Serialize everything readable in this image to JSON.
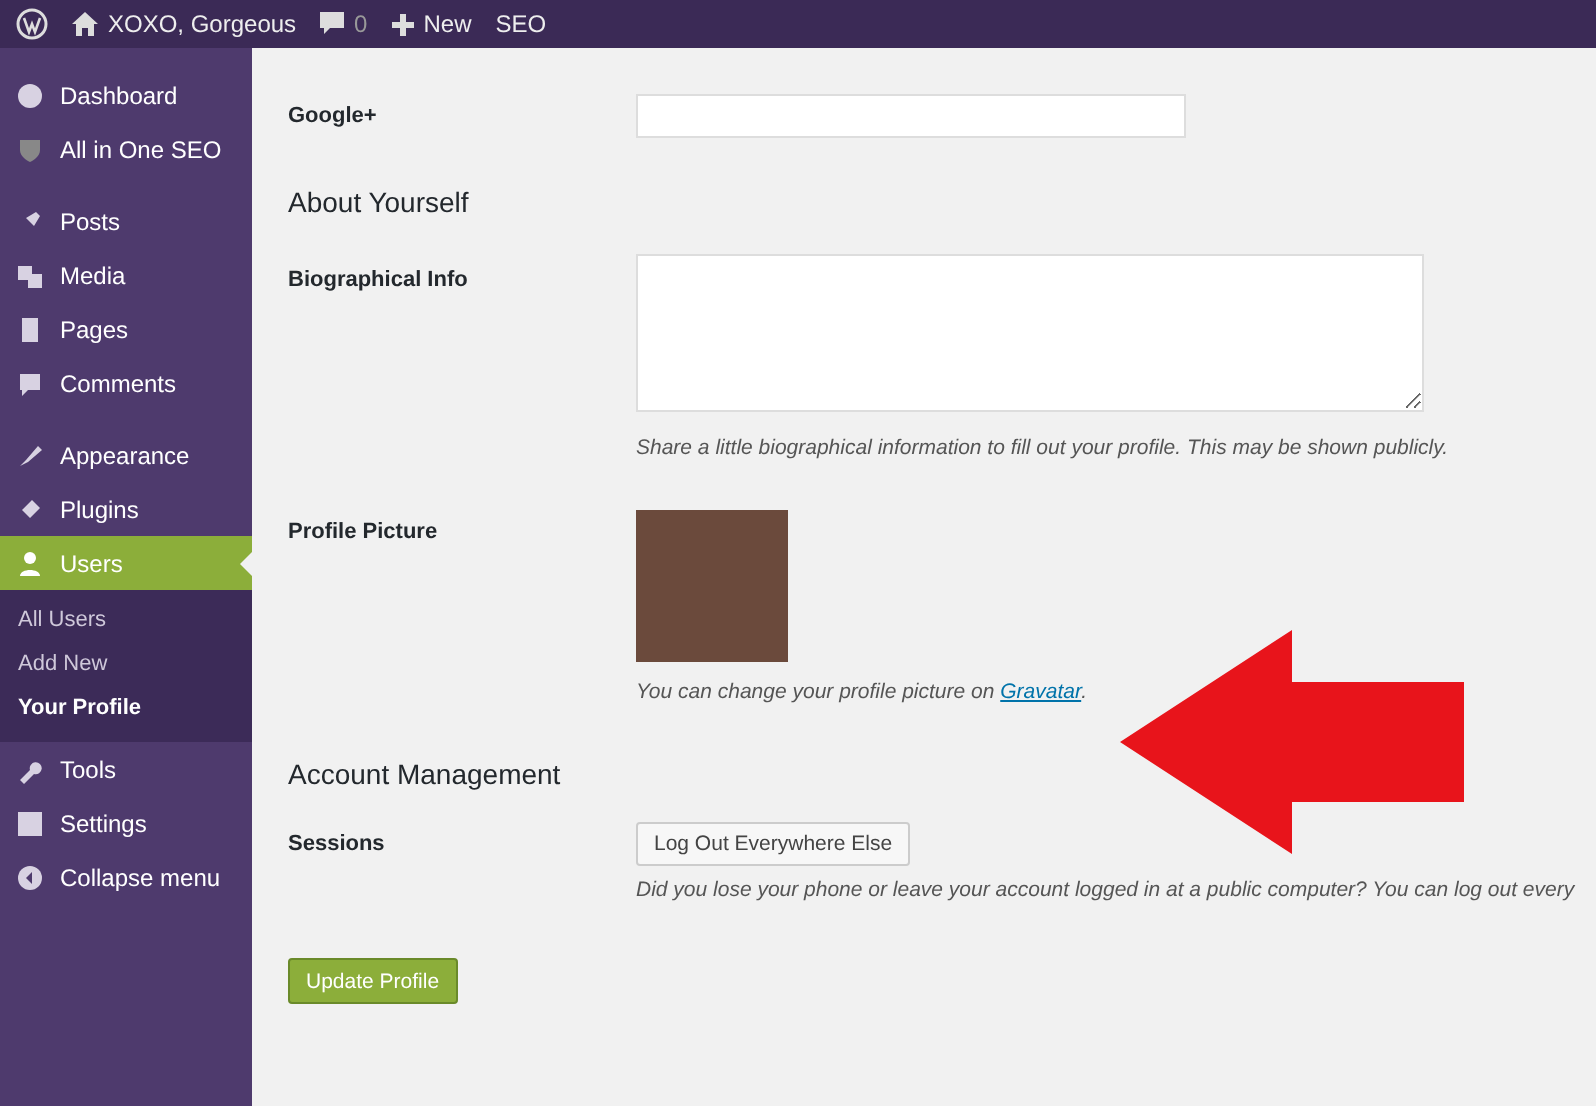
{
  "admin_bar": {
    "site_name": "XOXO, Gorgeous",
    "comments_count": "0",
    "new_label": "New",
    "seo_label": "SEO"
  },
  "sidebar": {
    "groups": [
      [
        {
          "label": "Dashboard",
          "selected": false
        },
        {
          "label": "All in One SEO",
          "selected": false
        }
      ],
      [
        {
          "label": "Posts",
          "selected": false
        },
        {
          "label": "Media",
          "selected": false
        },
        {
          "label": "Pages",
          "selected": false
        },
        {
          "label": "Comments",
          "selected": false
        }
      ],
      [
        {
          "label": "Appearance",
          "selected": false
        },
        {
          "label": "Plugins",
          "selected": false
        },
        {
          "label": "Users",
          "selected": true,
          "children": [
            {
              "label": "All Users",
              "selected": false
            },
            {
              "label": "Add New",
              "selected": false
            },
            {
              "label": "Your Profile",
              "selected": true
            }
          ]
        },
        {
          "label": "Tools",
          "selected": false
        },
        {
          "label": "Settings",
          "selected": false
        },
        {
          "label": "Collapse menu",
          "selected": false
        }
      ]
    ]
  },
  "form": {
    "google_plus": {
      "label": "Google+"
    },
    "about_heading": "About Yourself",
    "bio": {
      "label": "Biographical Info",
      "hint": "Share a little biographical information to fill out your profile. This may be shown publicly."
    },
    "picture": {
      "label": "Profile Picture",
      "hint_before": "You can change your profile picture on ",
      "link": "Gravatar",
      "hint_after": "."
    },
    "account_heading": "Account Management",
    "sessions": {
      "label": "Sessions",
      "button": "Log Out Everywhere Else",
      "hint": "Did you lose your phone or leave your account logged in at a public computer? You can log out every"
    },
    "submit": "Update Profile"
  }
}
